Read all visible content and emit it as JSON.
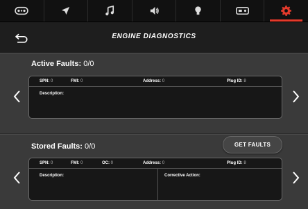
{
  "colors": {
    "accent": "#e53a2b",
    "background": "#3a3a3a",
    "tabbar": "#111111",
    "header": "#1e1e1e",
    "panel": "#171717"
  },
  "tabs": [
    {
      "icon": "gamepad-icon",
      "active": false
    },
    {
      "icon": "navigation-arrow-icon",
      "active": false
    },
    {
      "icon": "music-note-icon",
      "active": false
    },
    {
      "icon": "speaker-volume-icon",
      "active": false
    },
    {
      "icon": "light-bulb-icon",
      "active": false
    },
    {
      "icon": "radio-icon",
      "active": false
    },
    {
      "icon": "gear-icon",
      "active": true
    }
  ],
  "header": {
    "title": "ENGINE DIAGNOSTICS",
    "back_icon": "back-arrow-icon"
  },
  "active_faults": {
    "title": "Active Faults:",
    "count": "0/0",
    "fields": {
      "spn_label": "SPN:",
      "spn_value": "0",
      "fmi_label": "FMI:",
      "fmi_value": "0",
      "address_label": "Address:",
      "address_value": "0",
      "plug_label": "Plug ID:",
      "plug_value": "8"
    },
    "description_label": "Description:"
  },
  "stored_faults": {
    "title": "Stored Faults:",
    "count": "0/0",
    "get_faults_label": "GET FAULTS",
    "fields": {
      "spn_label": "SPN:",
      "spn_value": "0",
      "fmi_label": "FMI:",
      "fmi_value": "0",
      "oc_label": "OC:",
      "oc_value": "0",
      "address_label": "Address:",
      "address_value": "0",
      "plug_label": "Plug ID:",
      "plug_value": "8"
    },
    "description_label": "Description:",
    "corrective_label": "Corrective Action:"
  }
}
